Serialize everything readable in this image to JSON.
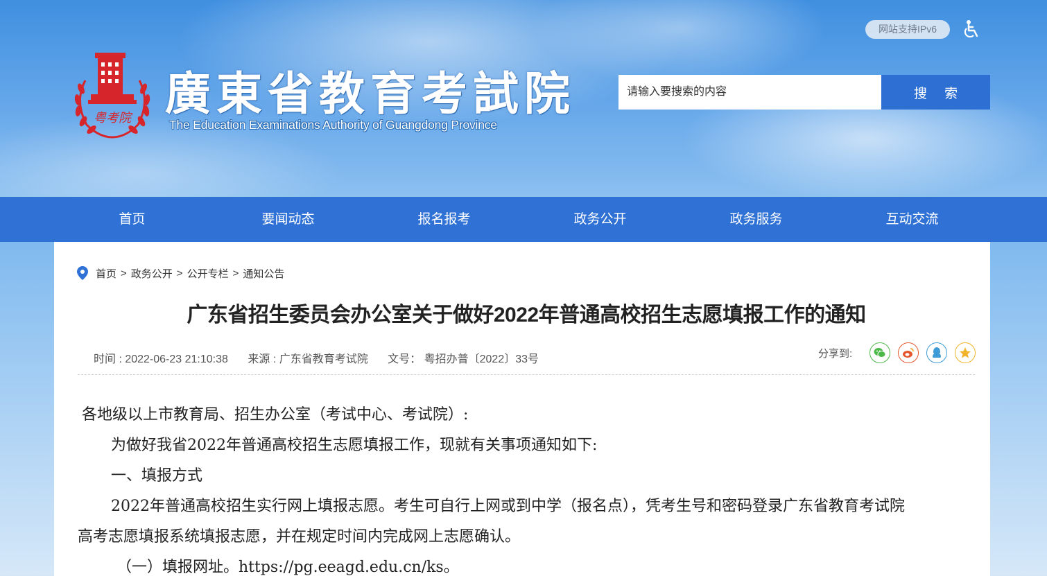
{
  "header": {
    "site_title": "廣東省教育考試院",
    "site_subtitle": "The Education Examinations Authority of Guangdong Province",
    "emblem_text": "粤考院",
    "ipv6_badge": "网站支持IPv6",
    "accessibility_icon": "wheelchair-icon",
    "search": {
      "placeholder": "请输入要搜索的内容",
      "button_label": "搜 索"
    }
  },
  "nav": {
    "items": [
      {
        "label": "首页"
      },
      {
        "label": "要闻动态"
      },
      {
        "label": "报名报考"
      },
      {
        "label": "政务公开"
      },
      {
        "label": "政务服务"
      },
      {
        "label": "互动交流"
      }
    ]
  },
  "breadcrumb": {
    "items": [
      "首页",
      "政务公开",
      "公开专栏",
      "通知公告"
    ],
    "separator": ">"
  },
  "article": {
    "title": "广东省招生委员会办公室关于做好2022年普通高校招生志愿填报工作的通知",
    "meta": {
      "time": "时间 : 2022-06-23 21:10:38",
      "source": "来源 : 广东省教育考试院",
      "doc_no": "文号： 粤招办普〔2022〕33号"
    },
    "share_label": "分享到:",
    "share_buttons": [
      {
        "icon": "wechat-icon",
        "color": "#4cb848"
      },
      {
        "icon": "weibo-icon",
        "color": "#e4572e"
      },
      {
        "icon": "qq-icon",
        "color": "#3d9bd6"
      },
      {
        "icon": "qzone-icon",
        "color": "#f0b429"
      }
    ],
    "paragraphs": [
      "各地级以上市教育局、招生办公室（考试中心、考试院）:",
      "为做好我省2022年普通高校招生志愿填报工作，现就有关事项通知如下:",
      "一、填报方式",
      "2022年普通高校招生实行网上填报志愿。考生可自行上网或到中学（报名点），凭考生号和密码登录广东省教育考试院",
      "高考志愿填报系统填报志愿，并在规定时间内完成网上志愿确认。",
      "（一）填报网址。https://pg.eeagd.edu.cn/ks。"
    ]
  },
  "colors": {
    "nav_bg": "#2f71d4",
    "search_button": "#2e6fd3",
    "emblem_red": "#d7262b"
  }
}
